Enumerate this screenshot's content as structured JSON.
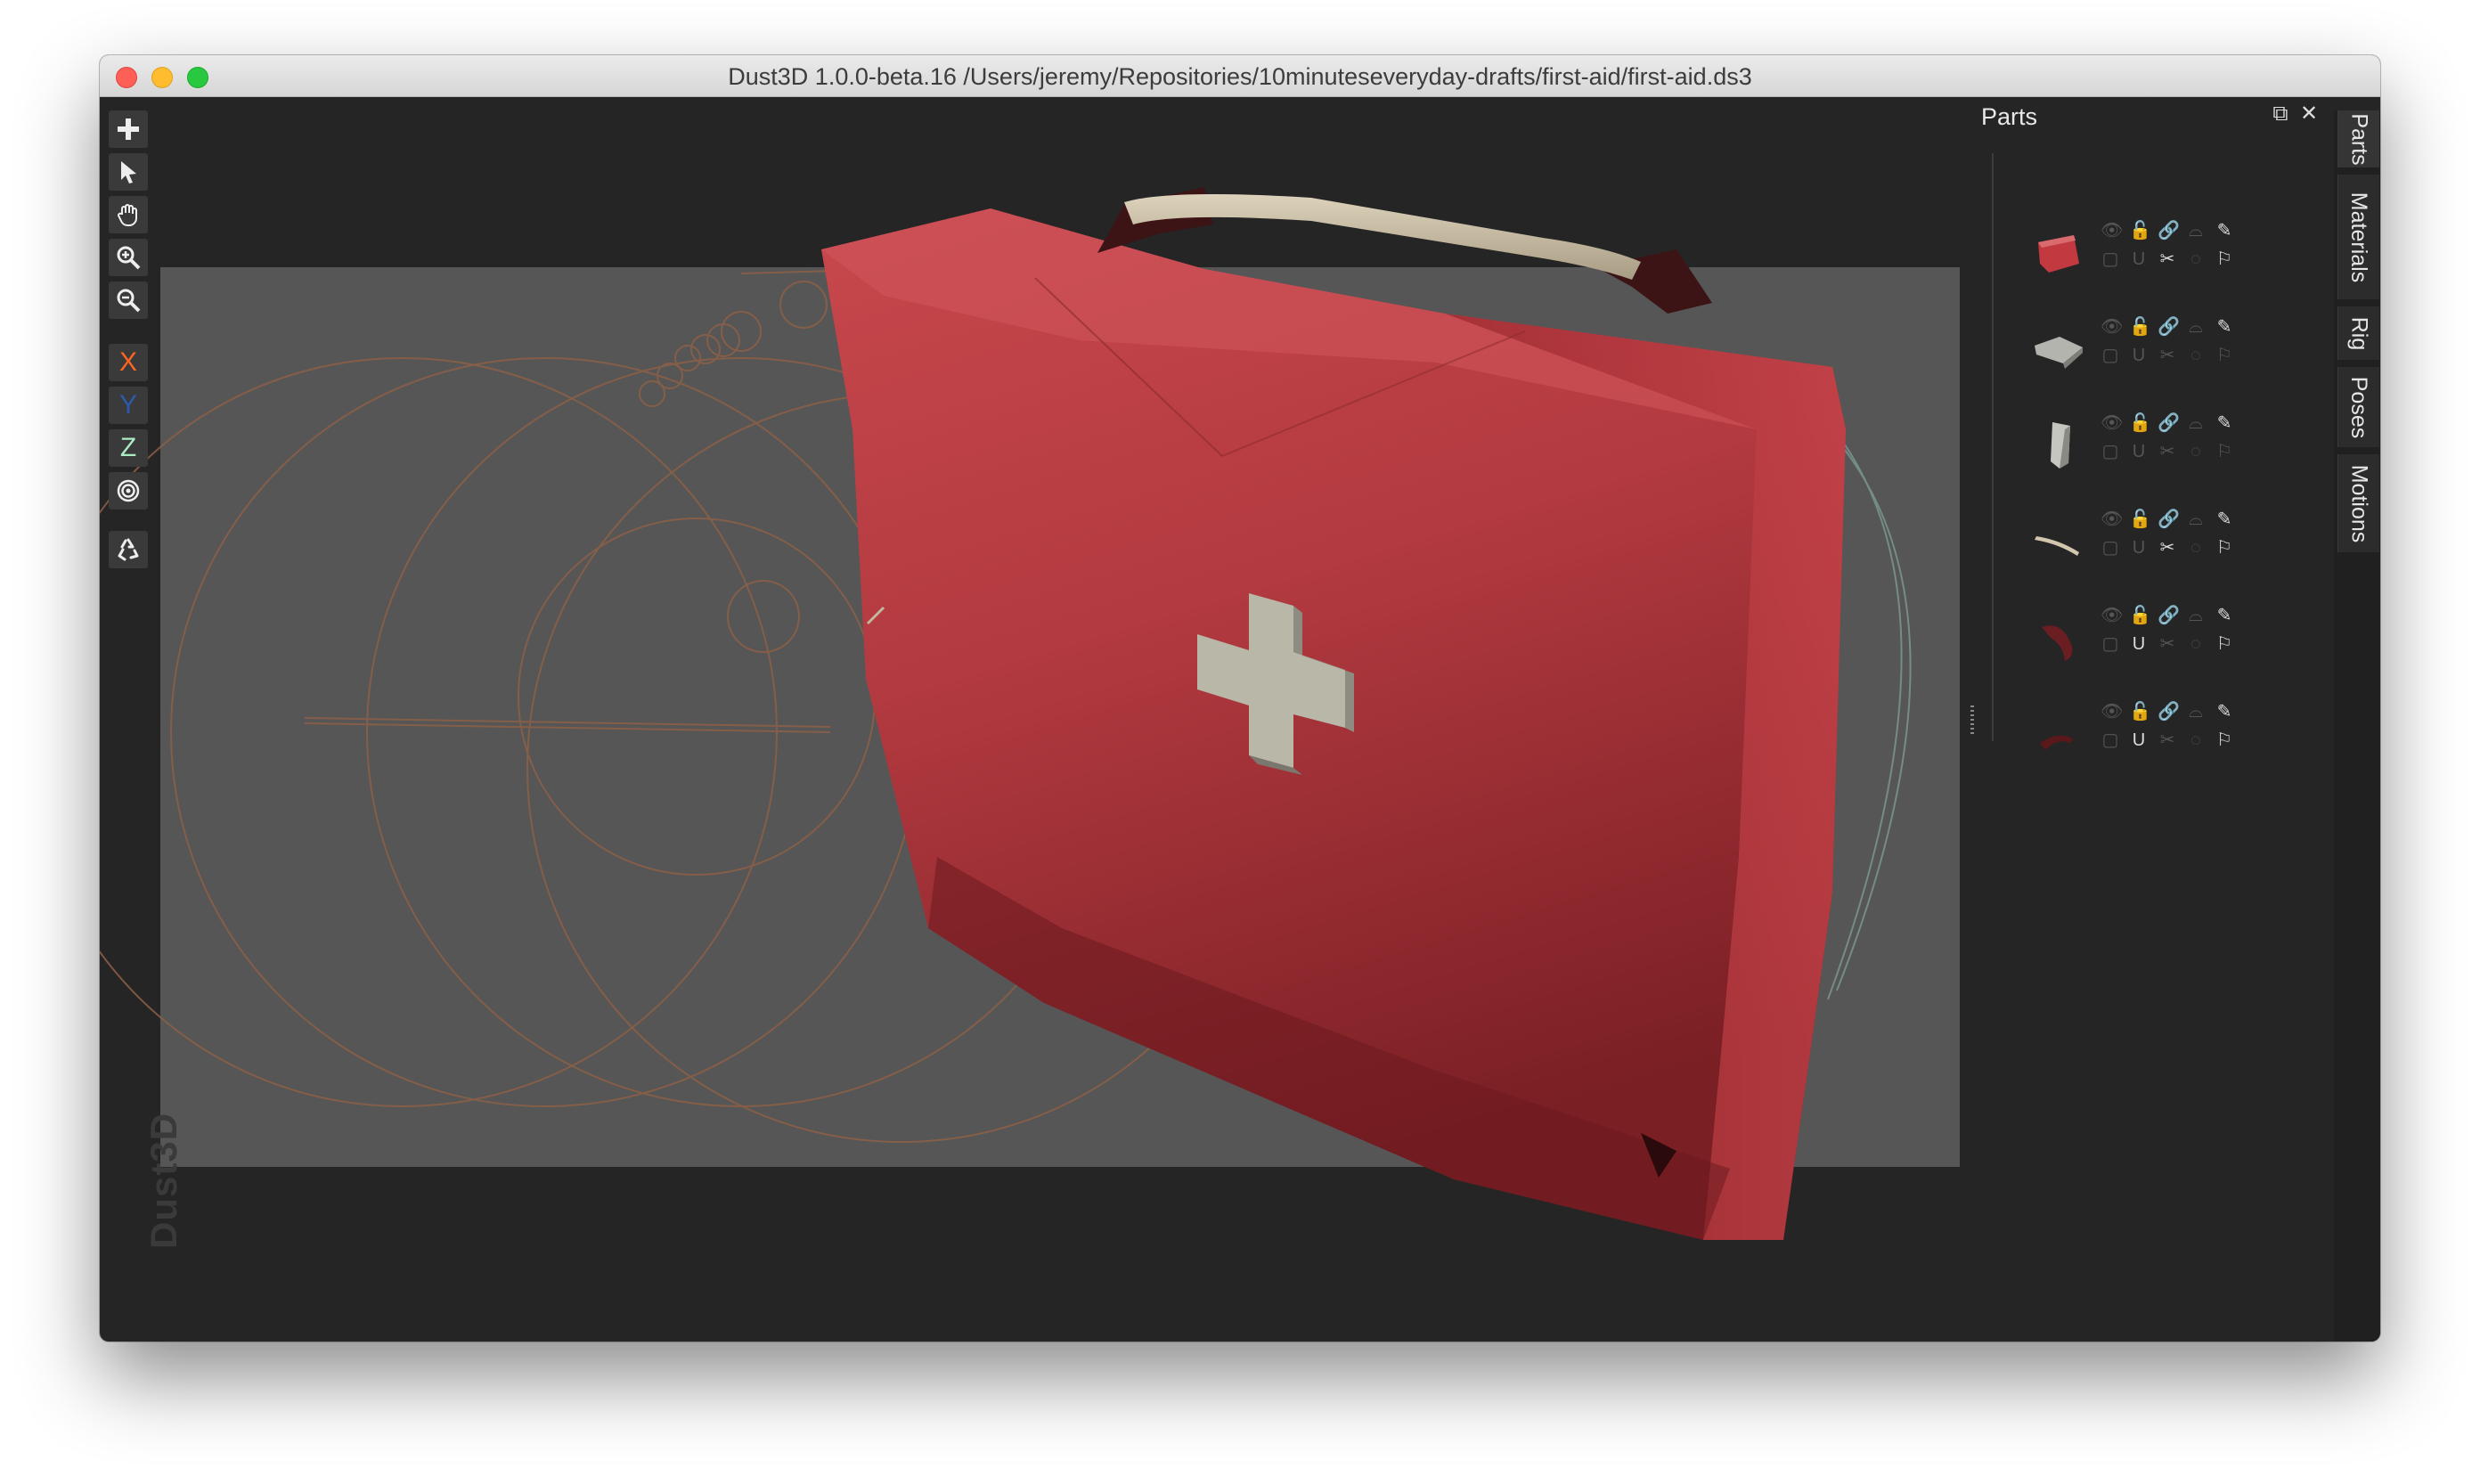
{
  "window": {
    "title": "Dust3D 1.0.0-beta.16 /Users/jeremy/Repositories/10minuteseveryday-drafts/first-aid/first-aid.ds3"
  },
  "toolbar": {
    "tools": [
      {
        "name": "add-icon",
        "glyph": "✚"
      },
      {
        "name": "select-icon",
        "glyph": ""
      },
      {
        "name": "pan-hand-icon",
        "glyph": ""
      },
      {
        "name": "zoom-in-icon",
        "glyph": ""
      },
      {
        "name": "zoom-out-icon",
        "glyph": ""
      }
    ],
    "axes": [
      {
        "label": "X",
        "color": "#fc6621"
      },
      {
        "label": "Y",
        "color": "#2a5aac"
      },
      {
        "label": "Z",
        "color": "#aaebc4"
      }
    ],
    "radius_icon": "radius-target-icon",
    "regenerate_icon": "recycle-icon"
  },
  "watermark": "Dust3D",
  "parts_panel": {
    "title": "Parts",
    "float_icon": "float-window-icon",
    "close_icon": "close-icon",
    "parts": [
      {
        "thumb": "red-case",
        "row2_highlight": [
          false,
          false,
          true,
          false,
          true
        ]
      },
      {
        "thumb": "grey-block",
        "row2_highlight": [
          false,
          false,
          false,
          false,
          false
        ]
      },
      {
        "thumb": "grey-plate",
        "row2_highlight": [
          false,
          false,
          false,
          false,
          false
        ]
      },
      {
        "thumb": "handle",
        "row2_highlight": [
          false,
          false,
          true,
          false,
          true
        ]
      },
      {
        "thumb": "dark-hook",
        "row2_highlight": [
          false,
          true,
          false,
          false,
          true
        ]
      },
      {
        "thumb": "dark-hook-small",
        "row2_highlight": [
          false,
          true,
          false,
          false,
          true
        ]
      }
    ]
  },
  "tabs": [
    "Parts",
    "Materials",
    "Rig",
    "Poses",
    "Motions"
  ],
  "colors": {
    "background": "#252525",
    "grid": "#565656",
    "case_red": "#b0363c",
    "cross": "#b9b7a8",
    "handle": "#cfc2a8"
  }
}
